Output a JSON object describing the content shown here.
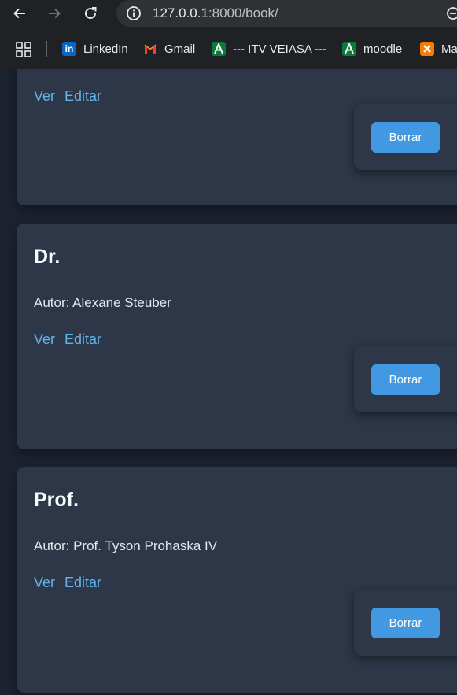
{
  "browser": {
    "url_host": "127.0.0.1",
    "url_path": ":8000/book/",
    "bookmarks": [
      {
        "label": "LinkedIn",
        "icon": "linkedin-icon",
        "color": "#0a66c2"
      },
      {
        "label": "Gmail",
        "icon": "gmail-icon",
        "color": "#ea4335"
      },
      {
        "label": "--- ITV VEIASA ---",
        "icon": "itv-veiasa-icon",
        "color": "#0b7a3b"
      },
      {
        "label": "moodle",
        "icon": "moodle-icon",
        "color": "#0b7a3b"
      },
      {
        "label": "Ma",
        "icon": "xampp-icon",
        "color": "#f57c00"
      }
    ]
  },
  "books": [
    {
      "title": "",
      "author": "",
      "view_label": "Ver",
      "edit_label": "Editar",
      "delete_label": "Borrar"
    },
    {
      "title": "Dr.",
      "author": "Autor: Alexane Steuber",
      "view_label": "Ver",
      "edit_label": "Editar",
      "delete_label": "Borrar"
    },
    {
      "title": "Prof.",
      "author": "Autor: Prof. Tyson Prohaska IV",
      "view_label": "Ver",
      "edit_label": "Editar",
      "delete_label": "Borrar"
    }
  ],
  "colors": {
    "card_bg": "#2d3748",
    "page_bg": "#1c2230",
    "link": "#63b3ed",
    "button": "#4299e1"
  }
}
